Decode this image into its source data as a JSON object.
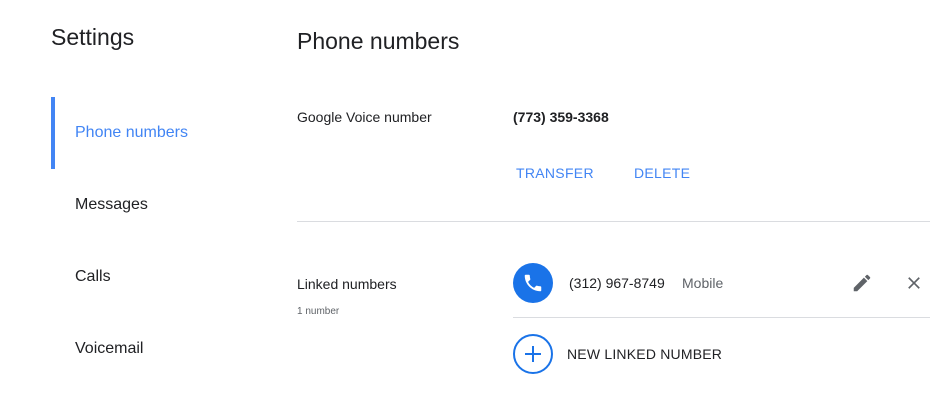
{
  "sidebar": {
    "title": "Settings",
    "items": [
      {
        "label": "Phone numbers",
        "active": true
      },
      {
        "label": "Messages",
        "active": false
      },
      {
        "label": "Calls",
        "active": false
      },
      {
        "label": "Voicemail",
        "active": false
      }
    ]
  },
  "main": {
    "title": "Phone numbers",
    "google_voice": {
      "label": "Google Voice number",
      "number": "(773) 359-3368",
      "transfer_label": "TRANSFER",
      "delete_label": "DELETE"
    },
    "linked": {
      "label": "Linked numbers",
      "count_text": "1 number",
      "numbers": [
        {
          "number": "(312) 967-8749",
          "type": "Mobile",
          "icon": "phone-icon"
        }
      ],
      "add_label": "NEW LINKED NUMBER"
    }
  },
  "colors": {
    "accent": "#4285f4",
    "phone_badge": "#1a73e8",
    "divider": "#dadce0"
  }
}
